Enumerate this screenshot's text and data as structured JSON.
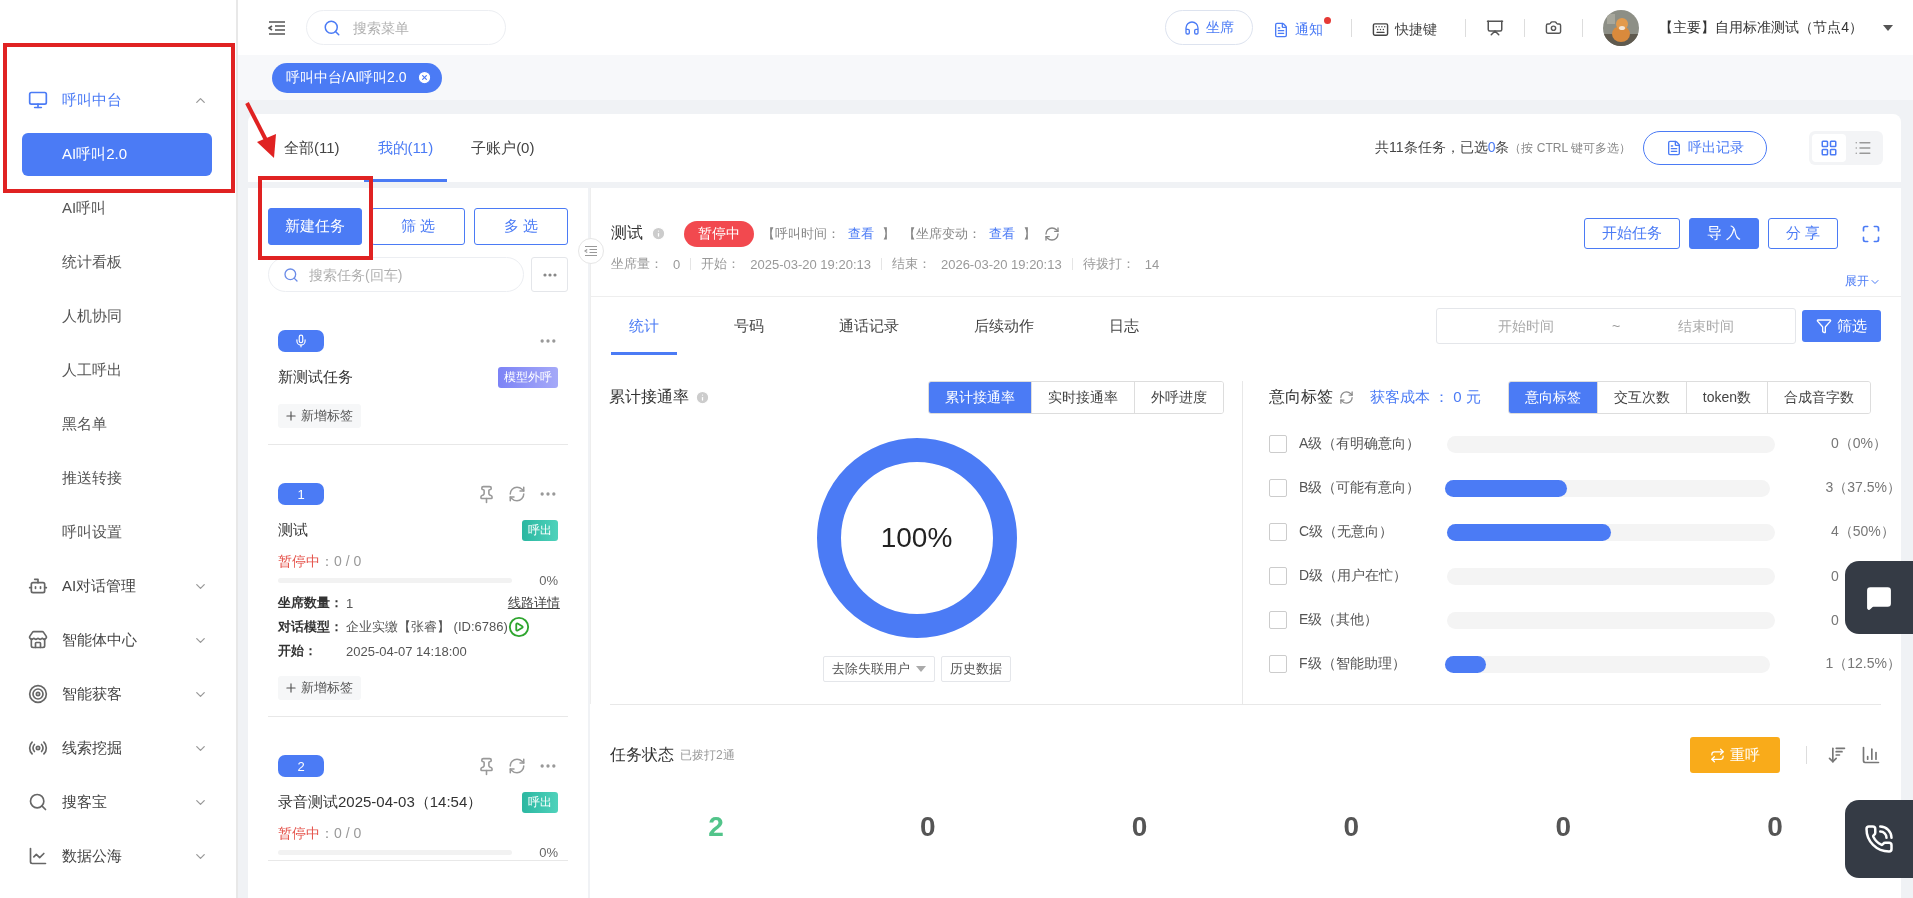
{
  "sidebar": {
    "groups": [
      {
        "label": "呼叫中台",
        "expanded": true,
        "children": [
          {
            "label": "AI呼叫2.0",
            "selected": true
          },
          {
            "label": "AI呼叫",
            "selected": false
          },
          {
            "label": "统计看板",
            "selected": false
          },
          {
            "label": "人机协同",
            "selected": false
          },
          {
            "label": "人工呼出",
            "selected": false
          },
          {
            "label": "黑名单",
            "selected": false
          },
          {
            "label": "推送转接",
            "selected": false
          },
          {
            "label": "呼叫设置",
            "selected": false
          }
        ]
      },
      {
        "label": "AI对话管理",
        "expanded": false
      },
      {
        "label": "智能体中心",
        "expanded": false
      },
      {
        "label": "智能获客",
        "expanded": false
      },
      {
        "label": "线索挖掘",
        "expanded": false
      },
      {
        "label": "搜客宝",
        "expanded": false
      },
      {
        "label": "数据公海",
        "expanded": false
      }
    ]
  },
  "topbar": {
    "search_placeholder": "搜索菜单",
    "seat_button": "坐席",
    "notice": {
      "label": "通知",
      "unread": true
    },
    "shortcut": "快捷键",
    "account": "【主要】自用标准测试（节点4）"
  },
  "open_tags": [
    {
      "label": "呼叫中台/AI呼叫2.0",
      "selected": true
    }
  ],
  "scope_tabs": [
    {
      "label": "全部(11)",
      "selected": false
    },
    {
      "label": "我的(11)",
      "selected": true
    },
    {
      "label": "子账户(0)",
      "selected": false
    }
  ],
  "summary": {
    "prefix": "共11条任务，已选",
    "selected_count": "0",
    "suffix": "条",
    "hint": "（按 CTRL 键可多选）"
  },
  "call_log_button": "呼出记录",
  "view_modes": [
    {
      "kind": "grid",
      "selected": true
    },
    {
      "kind": "list",
      "selected": false
    }
  ],
  "list_toolbar": {
    "buttons": [
      {
        "label": "新建任务",
        "primary": true
      },
      {
        "label": "筛 选",
        "primary": false
      },
      {
        "label": "多 选",
        "primary": false
      }
    ],
    "search_placeholder": "搜索任务(回车)"
  },
  "tasks": [
    {
      "kind": "model",
      "title": "新测试任务",
      "tag": "模型外呼",
      "add_tag": "新增标签"
    },
    {
      "kind": "outbound",
      "badge": "1",
      "title": "测试",
      "tag": "呼出",
      "status": "暂停中",
      "counts": "：0 / 0",
      "level": 0,
      "percent": "0%",
      "details": [
        {
          "label": "坐席数量：",
          "value": "1",
          "link": "线路详情"
        },
        {
          "label": "对话模型：",
          "value": "企业实缴【张睿】 (ID:6786)",
          "play": true
        },
        {
          "label": "开始：",
          "value": "2025-04-07 14:18:00"
        }
      ],
      "add_tag": "新增标签"
    },
    {
      "kind": "outbound",
      "badge": "2",
      "title": "录音测试2025-04-03（14:54）",
      "tag": "呼出",
      "status": "暂停中",
      "counts": "：0 / 0",
      "level": 0,
      "percent": "0%"
    }
  ],
  "detail": {
    "title": "测试",
    "status": "暂停中",
    "links": [
      {
        "prefix": "【呼叫时间：",
        "link": "查看",
        "suffix": "】"
      },
      {
        "prefix": "【坐席变动：",
        "link": "查看",
        "suffix": "】"
      }
    ],
    "meta": [
      {
        "label": "坐席量：",
        "value": "0"
      },
      {
        "label": "开始：",
        "value": "2025-03-20 19:20:13"
      },
      {
        "label": "结束：",
        "value": "2026-03-20 19:20:13"
      },
      {
        "label": "待拨打：",
        "value": "14"
      }
    ],
    "actions": [
      {
        "label": "开始任务",
        "primary": false
      },
      {
        "label": "导 入",
        "primary": true
      },
      {
        "label": "分 享",
        "primary": false
      }
    ],
    "expand": "展开",
    "tabs": [
      {
        "label": "统计",
        "selected": true
      },
      {
        "label": "号码",
        "selected": false
      },
      {
        "label": "通话记录",
        "selected": false
      },
      {
        "label": "后续动作",
        "selected": false
      },
      {
        "label": "日志",
        "selected": false
      }
    ],
    "date_range": {
      "start_placeholder": "开始时间",
      "separator": "~",
      "end_placeholder": "结束时间"
    },
    "filter_button": "筛选",
    "connect_rate": {
      "title": "累计接通率",
      "modes": [
        {
          "label": "累计接通率",
          "selected": true
        },
        {
          "label": "实时接通率",
          "selected": false
        },
        {
          "label": "外呼进度",
          "selected": false
        }
      ],
      "level": 1,
      "reading": "100%",
      "dropdown": "去除失联用户",
      "history_button": "历史数据"
    },
    "intent": {
      "title": "意向标签",
      "cost": "获客成本 ： 0 元",
      "modes": [
        {
          "label": "意向标签",
          "selected": true
        },
        {
          "label": "交互次数",
          "selected": false
        },
        {
          "label": "token数",
          "selected": false
        },
        {
          "label": "合成音字数",
          "selected": false
        }
      ],
      "rows": [
        {
          "label": "A级（有明确意向）",
          "checked": false,
          "level": 0,
          "reading": "0（0%）"
        },
        {
          "label": "B级（可能有意向）",
          "checked": false,
          "level": 0.375,
          "reading": "3（37.5%）"
        },
        {
          "label": "C级（无意向）",
          "checked": false,
          "level": 0.5,
          "reading": "4（50%）"
        },
        {
          "label": "D级（用户在忙）",
          "checked": false,
          "level": 0,
          "reading": "0"
        },
        {
          "label": "E级（其他）",
          "checked": false,
          "level": 0,
          "reading": "0"
        },
        {
          "label": "F级（智能助理）",
          "checked": false,
          "level": 0.125,
          "reading": "1（12.5%）"
        }
      ]
    },
    "task_status": {
      "title": "任务状态",
      "subtitle": "已拨打2通",
      "redial_button": "重呼",
      "stats": [
        {
          "value": "2",
          "color": "#52c48a"
        },
        {
          "value": "0",
          "color": "#555555"
        },
        {
          "value": "0",
          "color": "#555555"
        },
        {
          "value": "0",
          "color": "#555555"
        },
        {
          "value": "0",
          "color": "#555555"
        },
        {
          "value": "0",
          "color": "#555555"
        }
      ]
    }
  }
}
